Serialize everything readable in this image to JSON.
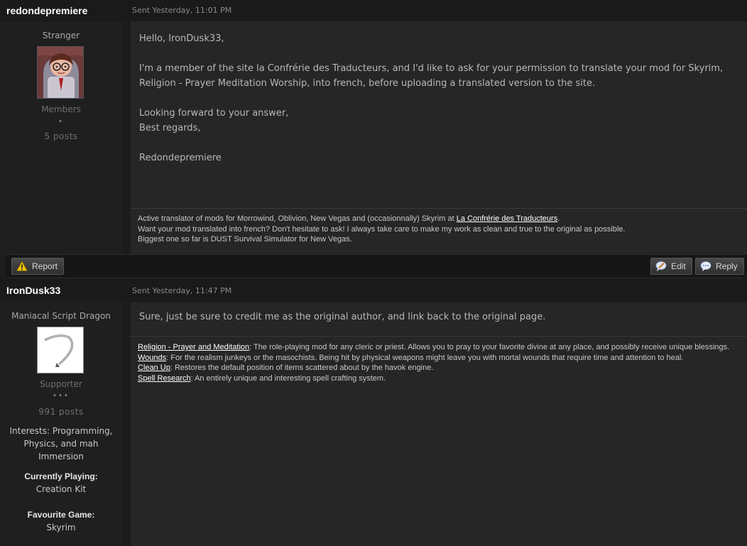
{
  "posts": [
    {
      "author": "redondepremiere",
      "date": "Sent Yesterday, 11:01 PM",
      "user_title": "Stranger",
      "group": "Members",
      "pips": "•",
      "post_count": "5 posts",
      "message": [
        "Hello, IronDusk33,",
        "I'm a member of the site la Confrérie des Traducteurs, and I'd like to ask for your permission to translate your mod for Skyrim,",
        "Religion - Prayer Meditation Worship, into french, before uploading a translated version to the site.",
        "Looking forward to your answer,",
        "Best regards,",
        "Redondepremiere"
      ],
      "signature": {
        "line1_text": "Active translator of mods for Morrowind, Oblivion, New Vegas and (occasionnally) Skyrim at ",
        "line1_link": "La Confrérie des Traducteurs",
        "line1_end": ".",
        "line2": "Want your mod translated into french? Don't hesitate to ask! I always take care to make my work as clean and true to the original as possible.",
        "line3": "Biggest one so far is DUST Survival Simulator for New Vegas."
      }
    },
    {
      "author": "IronDusk33",
      "date": "Sent Yesterday, 11:47 PM",
      "user_title": "Maniacal Script Dragon",
      "group": "Supporter",
      "pips": "•••",
      "post_count": "991 posts",
      "interests": "Interests: Programming, Physics, and mah Immersion",
      "currently_playing_label": "Currently Playing",
      "currently_playing_value": "Creation Kit",
      "favourite_game_label": "Favourite Game",
      "favourite_game_value": "Skyrim",
      "message": [
        "Sure, just be sure to credit me as the original author, and link back to the original page."
      ],
      "signature": [
        {
          "link": "Religion - Prayer and Meditation",
          "text": ": The role-playing mod for any cleric or priest. Allows you to pray to your favorite divine at any place, and possibly receive unique blessings."
        },
        {
          "link": "Wounds",
          "text": ": For the realism junkeys or the masochists. Being hit by physical weapons might leave you with mortal wounds that require time and attention to heal."
        },
        {
          "link": "Clean Up",
          "text": ": Restores the default position of items scattered about by the havok engine."
        },
        {
          "link": "Spell Research",
          "text": ": An entirely unique and interesting spell crafting system."
        }
      ]
    }
  ],
  "actions": {
    "report_label": "Report",
    "edit_label": "Edit",
    "reply_label": "Reply",
    "report_icon": "warning-icon",
    "edit_icon": "edit-bubble-icon",
    "reply_icon": "reply-bubble-icon"
  },
  "colors": {
    "background": "#1c1c1c",
    "post_body": "#262626",
    "username": "#ffffff",
    "warning": "#f2c400"
  }
}
